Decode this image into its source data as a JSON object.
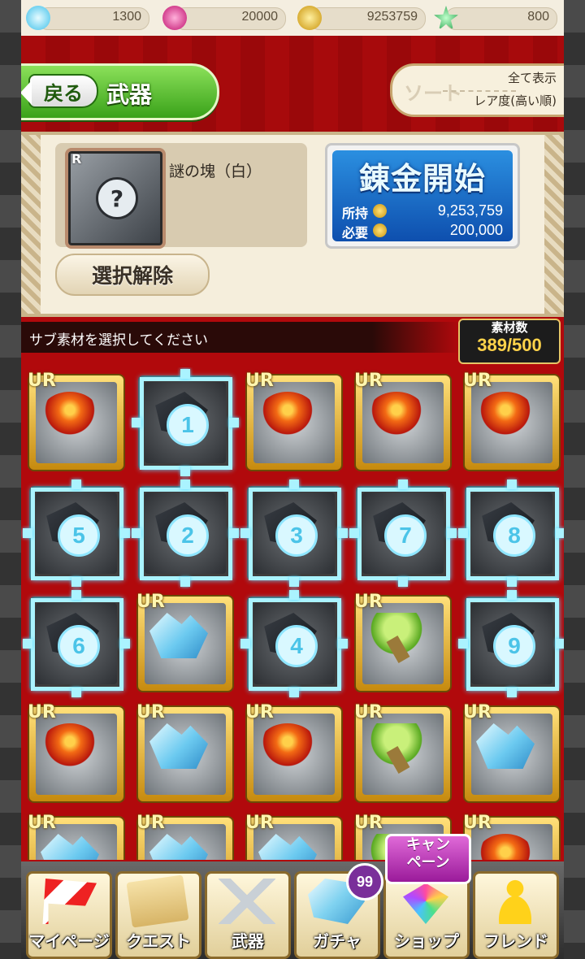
{
  "currencies": [
    {
      "name": "diamond-icon",
      "value": "1300",
      "color": "#7de0ff"
    },
    {
      "name": "pink-gem-icon",
      "value": "20000",
      "color": "#e0208c"
    },
    {
      "name": "gold-coin-icon",
      "value": "9253759",
      "color": "#e8b818"
    },
    {
      "name": "star-icon",
      "value": "800",
      "color": "#3cc860"
    }
  ],
  "header": {
    "back_label": "戻る",
    "title": "武器",
    "sort_label": "ソート",
    "sort_filter": "全て表示",
    "sort_order": "レア度(高い順)"
  },
  "selection": {
    "rarity": "R",
    "item_name": "謎の塊（白）",
    "deselect_label": "選択解除",
    "refine_label": "錬金開始",
    "owned_label": "所持",
    "owned_value": "9,253,759",
    "required_label": "必要",
    "required_value": "200,000"
  },
  "instruction": "サブ素材を選択してください",
  "material_count": {
    "label": "素材数",
    "value": "389/500"
  },
  "grid": {
    "rarity_label": "UR",
    "items": [
      {
        "art": "fire",
        "selected": false
      },
      {
        "art": "dark",
        "selected": true,
        "order": "1"
      },
      {
        "art": "fire",
        "selected": false
      },
      {
        "art": "fire",
        "selected": false
      },
      {
        "art": "fire",
        "selected": false
      },
      {
        "art": "dark",
        "selected": true,
        "order": "5"
      },
      {
        "art": "dark",
        "selected": true,
        "order": "2"
      },
      {
        "art": "dark",
        "selected": true,
        "order": "3"
      },
      {
        "art": "dark",
        "selected": true,
        "order": "7"
      },
      {
        "art": "dark",
        "selected": true,
        "order": "8"
      },
      {
        "art": "dark",
        "selected": true,
        "order": "6"
      },
      {
        "art": "ice",
        "selected": false
      },
      {
        "art": "dark",
        "selected": true,
        "order": "4"
      },
      {
        "art": "leaf",
        "selected": false
      },
      {
        "art": "dark",
        "selected": true,
        "order": "9"
      },
      {
        "art": "fire",
        "selected": false
      },
      {
        "art": "ice",
        "selected": false
      },
      {
        "art": "fire",
        "selected": false
      },
      {
        "art": "leaf",
        "selected": false
      },
      {
        "art": "ice",
        "selected": false
      },
      {
        "art": "ice",
        "selected": false
      },
      {
        "art": "ice",
        "selected": false
      },
      {
        "art": "ice",
        "selected": false
      },
      {
        "art": "leaf",
        "selected": false
      },
      {
        "art": "fire",
        "selected": false
      }
    ]
  },
  "nav": [
    {
      "label": "マイページ",
      "icon": "flag-icon"
    },
    {
      "label": "クエスト",
      "icon": "map-scroll-icon"
    },
    {
      "label": "武器",
      "icon": "crossed-swords-icon"
    },
    {
      "label": "ガチャ",
      "icon": "crystal-icon"
    },
    {
      "label": "ショップ",
      "icon": "gems-icon"
    },
    {
      "label": "フレンド",
      "icon": "person-icon"
    }
  ],
  "gacha_badge": "99",
  "campaign_line1": "キャン",
  "campaign_line2": "ペーン"
}
